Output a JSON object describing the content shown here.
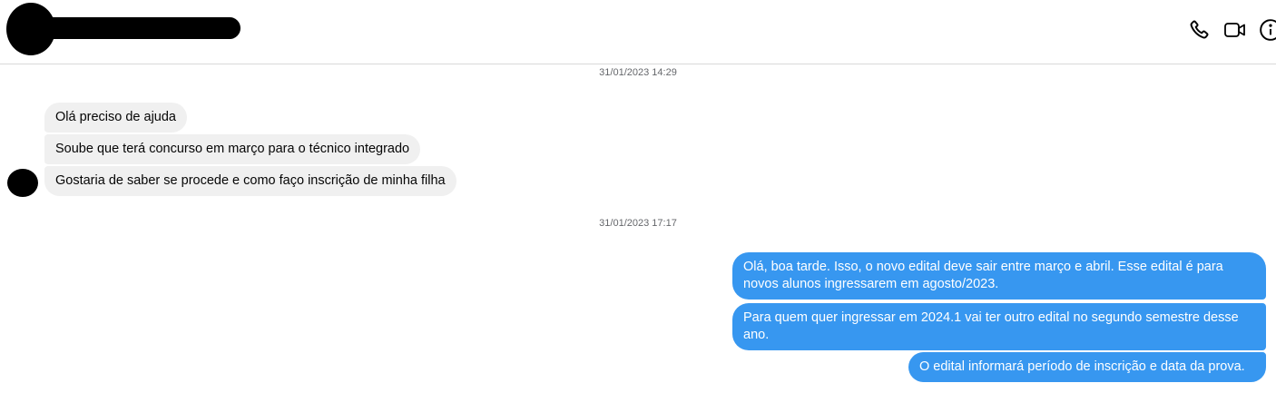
{
  "header": {
    "icons": [
      "phone-icon",
      "video-icon",
      "info-icon"
    ]
  },
  "timestamps": [
    "31/01/2023 14:29",
    "31/01/2023 17:17"
  ],
  "incoming": [
    "Olá preciso de  ajuda",
    "Soube que terá concurso em março para o técnico integrado",
    "Gostaria de saber se procede e como faço inscrição de minha filha"
  ],
  "outgoing": [
    "Olá, boa tarde. Isso, o novo edital deve sair entre março e abril. Esse edital é para novos alunos ingressarem em agosto/2023.",
    "Para quem quer ingressar em 2024.1 vai ter outro edital no segundo semestre desse ano.",
    "O edital informará período de inscrição e data da prova."
  ],
  "colors": {
    "outgoing_bubble": "#3797f0",
    "incoming_bubble": "#f0f0f0",
    "timestamp": "#65676b"
  }
}
